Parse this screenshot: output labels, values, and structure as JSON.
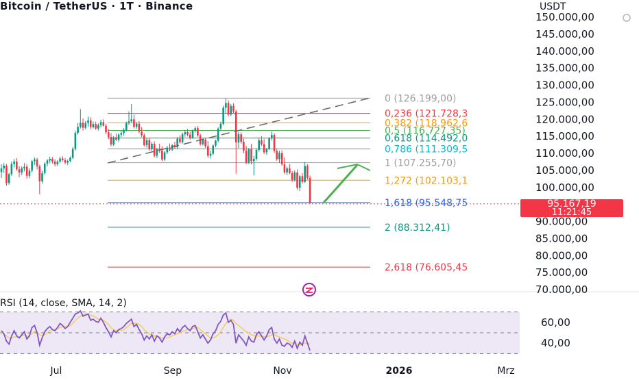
{
  "header": {
    "title": "Bitcoin / TetherUS · 1T · Binance",
    "currency": "USDT"
  },
  "price_tag": {
    "price": "95.167,19",
    "countdown": "11:21:45"
  },
  "rsi": {
    "title": "RSI (14, close, SMA, 14, 2)",
    "ticks": [
      "60,00",
      "40,00"
    ]
  },
  "colors": {
    "up": "#089981",
    "down": "#f23645",
    "rsi": "#7e57c2",
    "rsi_ma": "#f7c948",
    "arrow": "#4caf50",
    "rsi_band": "#ede7f6"
  },
  "chart_data": {
    "type": "candlestick",
    "title": "Bitcoin / TetherUS · 1T · Binance",
    "y_axis": {
      "unit": "USDT",
      "ticks": [
        "150.000,00",
        "145.000,00",
        "140.000,00",
        "135.000,00",
        "130.000,00",
        "125.000,00",
        "120.000,00",
        "115.000,00",
        "110.000,00",
        "105.000,00",
        "100.000,00",
        "95.000,00",
        "90.000,00",
        "85.000,00",
        "80.000,00",
        "75.000,00",
        "70.000,00"
      ],
      "ylim": [
        68000,
        151000
      ]
    },
    "x_axis": {
      "ticks": [
        "Jul",
        "Sep",
        "Nov",
        "2026",
        "Mrz"
      ]
    },
    "fib_levels": [
      {
        "ratio": 0,
        "label": "0 (126.199,00)",
        "value": 126199.0,
        "color": "#9e9e9e"
      },
      {
        "ratio": 0.236,
        "label": "0,236 (121.728,3",
        "value": 121728.3,
        "color": "#f23645"
      },
      {
        "ratio": 0.382,
        "label": "0,382 (118.962,6",
        "value": 118962.6,
        "color": "#ff9800"
      },
      {
        "ratio": 0.5,
        "label": "0,5 (116.727,35)",
        "value": 116727.35,
        "color": "#4caf50"
      },
      {
        "ratio": 0.618,
        "label": "0,618 (114.492,0",
        "value": 114492.0,
        "color": "#089981"
      },
      {
        "ratio": 0.786,
        "label": "0,786 (111.309,5",
        "value": 111309.5,
        "color": "#00bcd4"
      },
      {
        "ratio": 1,
        "label": "1 (107.255,70)",
        "value": 107255.7,
        "color": "#9e9e9e"
      },
      {
        "ratio": 1.272,
        "label": "1,272 (102.103,1",
        "value": 102103.1,
        "color": "#ff9800"
      },
      {
        "ratio": 1.618,
        "label": "1,618 (95.548,75",
        "value": 95548.75,
        "color": "#2962ff"
      },
      {
        "ratio": 2,
        "label": "2 (88.312,41)",
        "value": 88312.41,
        "color": "#089981"
      },
      {
        "ratio": 2.618,
        "label": "2,618 (76.605,45",
        "value": 76605.45,
        "color": "#f23645"
      }
    ],
    "current_price": 95167.19,
    "candles": [
      [
        104500,
        106800,
        102800,
        105600
      ],
      [
        105600,
        107200,
        104300,
        106400
      ],
      [
        106400,
        106900,
        100500,
        101300
      ],
      [
        101300,
        104300,
        100800,
        103900
      ],
      [
        103900,
        107600,
        103400,
        106900
      ],
      [
        106900,
        108300,
        105900,
        107600
      ],
      [
        107600,
        108600,
        104900,
        105300
      ],
      [
        105300,
        106300,
        103000,
        104400
      ],
      [
        104400,
        106200,
        103600,
        105600
      ],
      [
        105600,
        107100,
        104700,
        106100
      ],
      [
        106100,
        106900,
        102600,
        103400
      ],
      [
        103400,
        105600,
        102700,
        104900
      ],
      [
        104900,
        108100,
        104400,
        107700
      ],
      [
        107700,
        108800,
        106600,
        108200
      ],
      [
        108200,
        108700,
        105300,
        106200
      ],
      [
        106200,
        106700,
        98000,
        101800
      ],
      [
        101800,
        104900,
        101200,
        104200
      ],
      [
        104200,
        107400,
        103700,
        107000
      ],
      [
        107000,
        108300,
        106200,
        107900
      ],
      [
        107900,
        109000,
        107100,
        108400
      ],
      [
        108400,
        108900,
        107000,
        107600
      ],
      [
        107600,
        108300,
        106200,
        106800
      ],
      [
        106800,
        108000,
        106300,
        107600
      ],
      [
        107600,
        109000,
        107100,
        108500
      ],
      [
        108500,
        109200,
        107600,
        108000
      ],
      [
        108000,
        108600,
        106800,
        107300
      ],
      [
        107300,
        108200,
        106600,
        107800
      ],
      [
        107800,
        109100,
        107400,
        108700
      ],
      [
        108700,
        111800,
        108300,
        111300
      ],
      [
        111300,
        116700,
        110800,
        116000
      ],
      [
        116000,
        118900,
        115500,
        117800
      ],
      [
        117800,
        123000,
        117300,
        119000
      ],
      [
        119000,
        120200,
        116700,
        117500
      ],
      [
        117500,
        119500,
        117000,
        118900
      ],
      [
        118900,
        120800,
        117900,
        119700
      ],
      [
        119700,
        120600,
        117100,
        117700
      ],
      [
        117700,
        119400,
        117300,
        118600
      ],
      [
        118600,
        119300,
        116900,
        117300
      ],
      [
        117300,
        118800,
        116700,
        118300
      ],
      [
        118300,
        119900,
        117600,
        119200
      ],
      [
        119200,
        120000,
        117900,
        118100
      ],
      [
        118100,
        118700,
        115800,
        116200
      ],
      [
        116200,
        117200,
        114200,
        114800
      ],
      [
        114800,
        116000,
        112100,
        112600
      ],
      [
        112600,
        115100,
        112200,
        114700
      ],
      [
        114700,
        115800,
        113600,
        114000
      ],
      [
        114000,
        115900,
        113300,
        115500
      ],
      [
        115500,
        116700,
        114800,
        116000
      ],
      [
        116000,
        117400,
        115200,
        116800
      ],
      [
        116800,
        119300,
        116400,
        118900
      ],
      [
        118900,
        122300,
        118300,
        119400
      ],
      [
        119400,
        124500,
        119000,
        120000
      ],
      [
        120000,
        121400,
        117300,
        117800
      ],
      [
        117800,
        119200,
        117200,
        118700
      ],
      [
        118700,
        119500,
        115900,
        116400
      ],
      [
        116400,
        117700,
        114800,
        115300
      ],
      [
        115300,
        115900,
        112000,
        112400
      ],
      [
        112400,
        114400,
        111700,
        113900
      ],
      [
        113900,
        114600,
        110800,
        111300
      ],
      [
        111300,
        113300,
        110700,
        112800
      ],
      [
        112800,
        113500,
        108800,
        109300
      ],
      [
        109300,
        111600,
        108600,
        111200
      ],
      [
        111200,
        112800,
        110200,
        110800
      ],
      [
        110800,
        112100,
        107700,
        108200
      ],
      [
        108200,
        110700,
        107800,
        110300
      ],
      [
        110300,
        112200,
        109800,
        111700
      ],
      [
        111700,
        112900,
        110600,
        111100
      ],
      [
        111100,
        112700,
        110700,
        112400
      ],
      [
        112400,
        113400,
        111400,
        111800
      ],
      [
        111800,
        114800,
        111400,
        114300
      ],
      [
        114300,
        115300,
        112900,
        113300
      ],
      [
        113300,
        116100,
        112900,
        115600
      ],
      [
        115600,
        116900,
        114900,
        116200
      ],
      [
        116200,
        117200,
        115000,
        115500
      ],
      [
        115500,
        116400,
        114000,
        114600
      ],
      [
        114600,
        117000,
        114300,
        116700
      ],
      [
        116700,
        117900,
        116100,
        117400
      ],
      [
        117400,
        118000,
        114900,
        115300
      ],
      [
        115300,
        115800,
        112300,
        112700
      ],
      [
        112700,
        114300,
        112300,
        114000
      ],
      [
        114000,
        114500,
        111600,
        112100
      ],
      [
        112100,
        113600,
        108700,
        109300
      ],
      [
        109300,
        110800,
        108500,
        109900
      ],
      [
        109900,
        112600,
        109500,
        112300
      ],
      [
        112300,
        114000,
        111800,
        113700
      ],
      [
        113700,
        117600,
        113200,
        117300
      ],
      [
        117300,
        119300,
        116800,
        118700
      ],
      [
        118700,
        124000,
        118200,
        123400
      ],
      [
        123400,
        126200,
        121800,
        124800
      ],
      [
        124800,
        125600,
        120800,
        121400
      ],
      [
        121400,
        124500,
        121000,
        123900
      ],
      [
        123900,
        124700,
        121800,
        122300
      ],
      [
        122300,
        122800,
        104000,
        113200
      ],
      [
        113200,
        116300,
        111600,
        115600
      ],
      [
        115600,
        116200,
        112800,
        113400
      ],
      [
        113400,
        114300,
        110000,
        110800
      ],
      [
        110800,
        112200,
        106800,
        107300
      ],
      [
        107300,
        111600,
        106900,
        111200
      ],
      [
        111200,
        112800,
        106800,
        107700
      ],
      [
        107700,
        109300,
        103500,
        108400
      ],
      [
        108400,
        111500,
        107900,
        111000
      ],
      [
        111000,
        114400,
        110500,
        113800
      ],
      [
        113800,
        115000,
        112200,
        112700
      ],
      [
        112700,
        114200,
        109800,
        110300
      ],
      [
        110300,
        111600,
        109600,
        111300
      ],
      [
        111300,
        114700,
        111000,
        114400
      ],
      [
        114400,
        116400,
        113800,
        115400
      ],
      [
        115400,
        115900,
        110200,
        110700
      ],
      [
        110700,
        111400,
        107800,
        108300
      ],
      [
        108300,
        110800,
        107200,
        110100
      ],
      [
        110100,
        110900,
        106300,
        106800
      ],
      [
        106800,
        108800,
        103900,
        104400
      ],
      [
        104400,
        106100,
        103600,
        105600
      ],
      [
        105600,
        106900,
        103900,
        104200
      ],
      [
        104200,
        104800,
        101600,
        102200
      ],
      [
        102200,
        105000,
        101700,
        104400
      ],
      [
        104400,
        105300,
        99300,
        99900
      ],
      [
        99900,
        103600,
        98900,
        103300
      ],
      [
        103300,
        104200,
        101100,
        101600
      ],
      [
        101600,
        107500,
        101300,
        106300
      ],
      [
        106300,
        106800,
        102300,
        102800
      ],
      [
        102800,
        103500,
        95200,
        95600
      ]
    ],
    "rsi_series": [
      52,
      49,
      42,
      39,
      47,
      52,
      47,
      45,
      48,
      51,
      44,
      47,
      55,
      57,
      50,
      38,
      45,
      51,
      54,
      56,
      53,
      52,
      55,
      59,
      57,
      54,
      56,
      60,
      64,
      68,
      69,
      71,
      66,
      67,
      68,
      62,
      63,
      61,
      60,
      64,
      60,
      55,
      51,
      46,
      52,
      50,
      53,
      54,
      56,
      59,
      61,
      63,
      56,
      58,
      53,
      49,
      43,
      47,
      44,
      48,
      42,
      47,
      45,
      41,
      46,
      49,
      48,
      51,
      49,
      54,
      51,
      55,
      57,
      54,
      52,
      56,
      57,
      51,
      45,
      48,
      44,
      40,
      43,
      49,
      52,
      58,
      61,
      67,
      69,
      60,
      62,
      58,
      40,
      48,
      45,
      42,
      38,
      46,
      42,
      41,
      48,
      51,
      47,
      43,
      47,
      53,
      55,
      44,
      40,
      44,
      38,
      37,
      40,
      39,
      36,
      42,
      35,
      41,
      38,
      47,
      40,
      33
    ],
    "rsi_ma_series": [
      50,
      49,
      47,
      45,
      45,
      46,
      46,
      46,
      47,
      48,
      47,
      47,
      49,
      51,
      51,
      48,
      47,
      48,
      50,
      52,
      53,
      53,
      54,
      55,
      56,
      56,
      56,
      57,
      59,
      62,
      64,
      66,
      67,
      68,
      68,
      67,
      66,
      65,
      63,
      63,
      62,
      60,
      58,
      55,
      53,
      52,
      52,
      52,
      53,
      55,
      57,
      59,
      59,
      59,
      58,
      56,
      53,
      51,
      49,
      48,
      47,
      47,
      46,
      45,
      45,
      45,
      46,
      47,
      48,
      49,
      50,
      51,
      52,
      53,
      53,
      54,
      55,
      55,
      53,
      51,
      49,
      47,
      45,
      45,
      46,
      48,
      51,
      55,
      59,
      62,
      63,
      62,
      59,
      57,
      55,
      53,
      51,
      50,
      48,
      47,
      47,
      47,
      47,
      46,
      46,
      47,
      48,
      48,
      47,
      46,
      45,
      44,
      43,
      41,
      40,
      40,
      39,
      39,
      39,
      40,
      40,
      39
    ],
    "rsi_ylim": [
      25,
      75
    ]
  }
}
